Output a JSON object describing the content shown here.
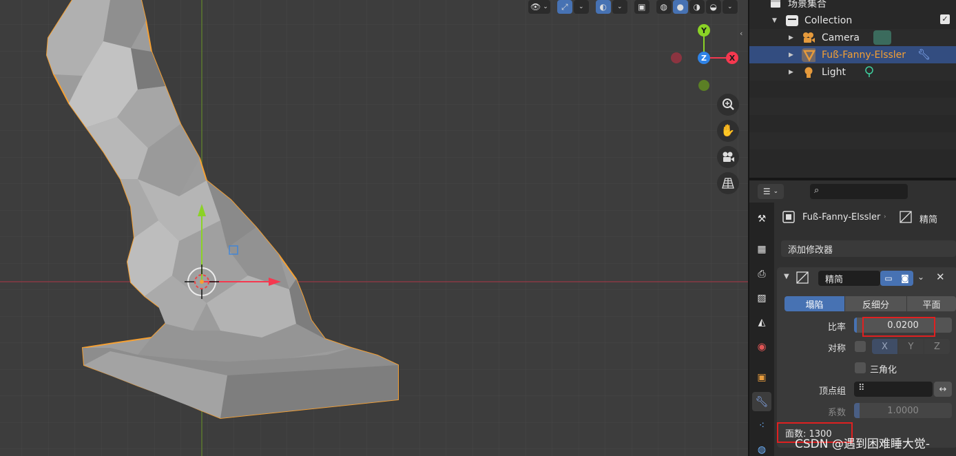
{
  "outliner": {
    "scene_collection": "场景集合",
    "rows": [
      {
        "label": "Collection"
      },
      {
        "label": "Camera"
      },
      {
        "label": "Fuß-Fanny-Elssler"
      },
      {
        "label": "Light"
      }
    ]
  },
  "properties": {
    "breadcrumb_object": "Fuß-Fanny-Elssler",
    "breadcrumb_modifier": "精简",
    "add_modifier": "添加修改器",
    "modifier_name": "精简",
    "modes": [
      "塌陷",
      "反细分",
      "平面"
    ],
    "active_mode": "塌陷",
    "ratio_label": "比率",
    "ratio_value": "0.0200",
    "symmetry_label": "对称",
    "axes": [
      "X",
      "Y",
      "Z"
    ],
    "triangulate_label": "三角化",
    "vertex_group_label": "顶点组",
    "factor_label": "系数",
    "factor_value": "1.0000",
    "face_count": "面数: 1300"
  },
  "gizmo": {
    "y": "Y",
    "z": "Z",
    "x": "X"
  },
  "watermark": "CSDN @遇到困难睡大觉-",
  "colors": {
    "selection_outline": "#f5a033",
    "accent_blue": "#4772b3",
    "highlight_red": "#e02020",
    "axis_x": "#f5384f",
    "axis_y": "#8bd226",
    "axis_z": "#2f83e6"
  }
}
